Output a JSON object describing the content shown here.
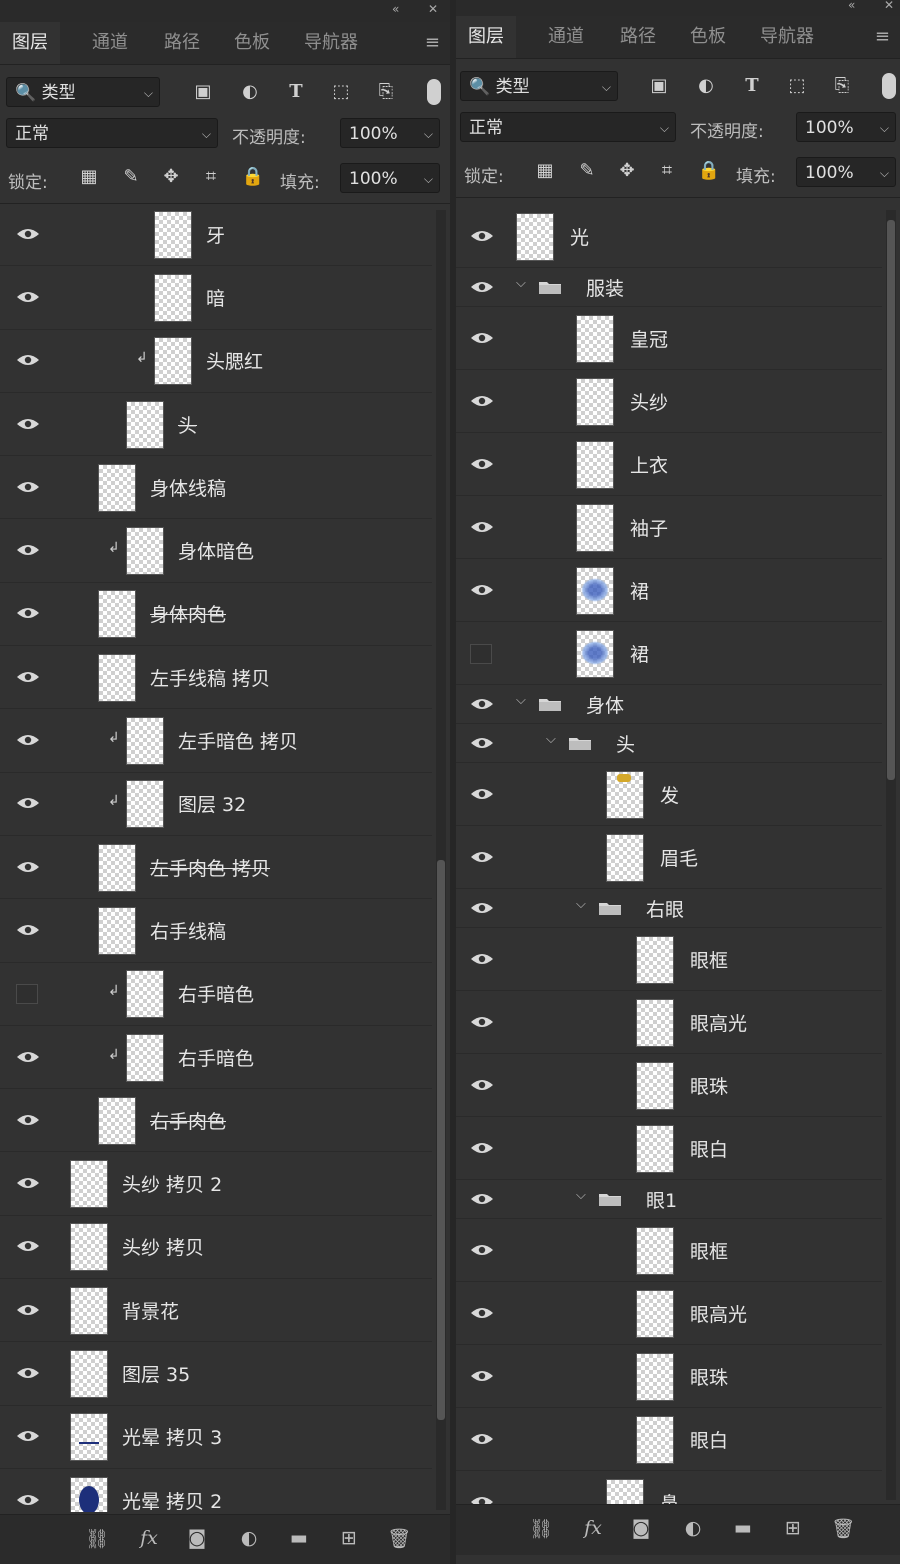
{
  "left": {
    "tabs": [
      "图层",
      "通道",
      "路径",
      "色板",
      "导航器"
    ],
    "filter_value": "类型",
    "blend_mode": "正常",
    "opacity_label": "不透明度:",
    "opacity_value": "100%",
    "lock_label": "锁定:",
    "fill_label": "填充:",
    "fill_value": "100%",
    "layers": [
      {
        "name": "牙",
        "indent": 3,
        "clip": false,
        "visible": true,
        "strike": false
      },
      {
        "name": "暗",
        "indent": 3,
        "clip": false,
        "visible": true,
        "strike": false
      },
      {
        "name": "头腮红",
        "indent": 3,
        "clip": true,
        "visible": true,
        "strike": false
      },
      {
        "name": "头",
        "indent": 2,
        "clip": false,
        "visible": true,
        "strike": true
      },
      {
        "name": "身体线稿",
        "indent": 1,
        "clip": false,
        "visible": true,
        "strike": false
      },
      {
        "name": "身体暗色",
        "indent": 2,
        "clip": true,
        "visible": true,
        "strike": false
      },
      {
        "name": "身体肉色",
        "indent": 1,
        "clip": false,
        "visible": true,
        "strike": true
      },
      {
        "name": "左手线稿 拷贝",
        "indent": 1,
        "clip": false,
        "visible": true,
        "strike": false
      },
      {
        "name": "左手暗色 拷贝",
        "indent": 2,
        "clip": true,
        "visible": true,
        "strike": false
      },
      {
        "name": "图层 32",
        "indent": 2,
        "clip": true,
        "visible": true,
        "strike": false
      },
      {
        "name": "左手肉色 拷贝",
        "indent": 1,
        "clip": false,
        "visible": true,
        "strike": true
      },
      {
        "name": "右手线稿",
        "indent": 1,
        "clip": false,
        "visible": true,
        "strike": false
      },
      {
        "name": "右手暗色",
        "indent": 2,
        "clip": true,
        "visible": false,
        "strike": false
      },
      {
        "name": "右手暗色",
        "indent": 2,
        "clip": true,
        "visible": true,
        "strike": false
      },
      {
        "name": "右手肉色",
        "indent": 1,
        "clip": false,
        "visible": true,
        "strike": true
      },
      {
        "name": "头纱 拷贝 2",
        "indent": 0,
        "clip": false,
        "visible": true,
        "strike": false
      },
      {
        "name": "头纱 拷贝",
        "indent": 0,
        "clip": false,
        "visible": true,
        "strike": false
      },
      {
        "name": "背景花",
        "indent": 0,
        "clip": false,
        "visible": true,
        "strike": false
      },
      {
        "name": "图层 35",
        "indent": 0,
        "clip": false,
        "visible": true,
        "strike": false
      },
      {
        "name": "光晕 拷贝 3",
        "indent": 0,
        "clip": false,
        "visible": true,
        "strike": false,
        "thumb": "line"
      },
      {
        "name": "光晕 拷贝 2",
        "indent": 0,
        "clip": false,
        "visible": true,
        "strike": false,
        "thumb": "blob"
      }
    ]
  },
  "right": {
    "tabs": [
      "图层",
      "通道",
      "路径",
      "色板",
      "导航器"
    ],
    "filter_value": "类型",
    "blend_mode": "正常",
    "opacity_label": "不透明度:",
    "opacity_value": "100%",
    "lock_label": "锁定:",
    "fill_label": "填充:",
    "fill_value": "100%",
    "layers": [
      {
        "name": "光",
        "indent": 0,
        "type": "layer",
        "visible": true
      },
      {
        "name": "服装",
        "indent": 0,
        "type": "group",
        "visible": true
      },
      {
        "name": "皇冠",
        "indent": 1,
        "type": "layer",
        "visible": true
      },
      {
        "name": "头纱",
        "indent": 1,
        "type": "layer",
        "visible": true
      },
      {
        "name": "上衣",
        "indent": 1,
        "type": "layer",
        "visible": true
      },
      {
        "name": "袖子",
        "indent": 1,
        "type": "layer",
        "visible": true
      },
      {
        "name": "裙",
        "indent": 1,
        "type": "layer",
        "visible": true,
        "thumb": "pattern"
      },
      {
        "name": "裙",
        "indent": 1,
        "type": "layer",
        "visible": false,
        "thumb": "pattern"
      },
      {
        "name": "身体",
        "indent": 0,
        "type": "group",
        "visible": true
      },
      {
        "name": "头",
        "indent": 1,
        "type": "group",
        "visible": true
      },
      {
        "name": "发",
        "indent": 2,
        "type": "layer",
        "visible": true,
        "thumb": "hair"
      },
      {
        "name": "眉毛",
        "indent": 2,
        "type": "layer",
        "visible": true
      },
      {
        "name": "右眼",
        "indent": 2,
        "type": "group",
        "visible": true
      },
      {
        "name": "眼框",
        "indent": 3,
        "type": "layer",
        "visible": true
      },
      {
        "name": "眼高光",
        "indent": 3,
        "type": "layer",
        "visible": true
      },
      {
        "name": "眼珠",
        "indent": 3,
        "type": "layer",
        "visible": true
      },
      {
        "name": "眼白",
        "indent": 3,
        "type": "layer",
        "visible": true
      },
      {
        "name": "眼1",
        "indent": 2,
        "type": "group",
        "visible": true
      },
      {
        "name": "眼框",
        "indent": 3,
        "type": "layer",
        "visible": true
      },
      {
        "name": "眼高光",
        "indent": 3,
        "type": "layer",
        "visible": true
      },
      {
        "name": "眼珠",
        "indent": 3,
        "type": "layer",
        "visible": true
      },
      {
        "name": "眼白",
        "indent": 3,
        "type": "layer",
        "visible": true
      },
      {
        "name": "鼻",
        "indent": 2,
        "type": "layer",
        "visible": true
      }
    ]
  },
  "icons": {
    "search": "search-icon",
    "image_filter": "image-filter-icon",
    "adjust_filter": "adjustment-filter-icon",
    "type_filter": "type-filter-icon",
    "shape_filter": "shape-filter-icon",
    "smart_filter": "smart-object-filter-icon",
    "lock_pixels": "lock-transparent-icon",
    "lock_brush": "lock-image-icon",
    "lock_move": "lock-position-icon",
    "lock_artboard": "lock-artboard-icon",
    "lock_all": "lock-all-icon",
    "bottom": [
      "link-icon",
      "fx-icon",
      "mask-icon",
      "adjustment-layer-icon",
      "new-group-icon",
      "new-layer-icon",
      "trash-icon"
    ]
  },
  "colors": {
    "panel_bg": "#323232",
    "tab_bg": "#2b2b2b",
    "text": "#e6e6e6"
  }
}
